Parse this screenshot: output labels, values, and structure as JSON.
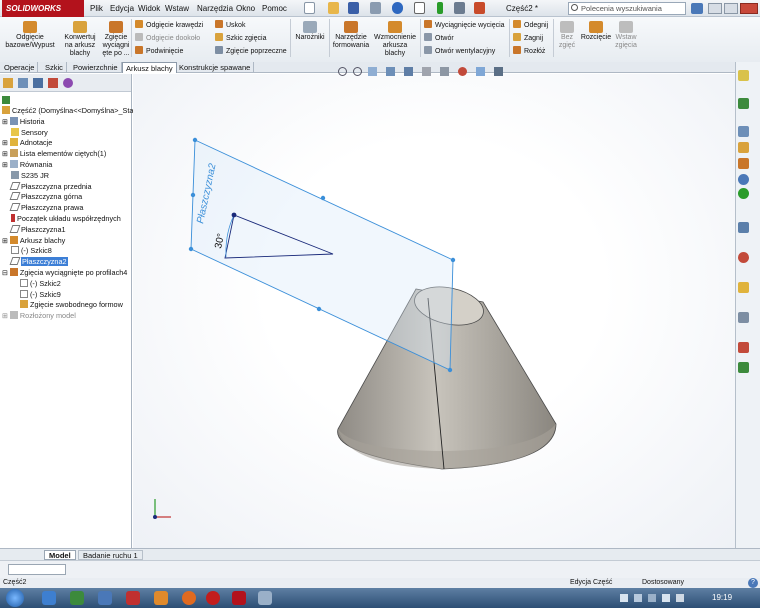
{
  "app": {
    "logo": "SOLIDWORKS",
    "doc_title": "Część2 *",
    "search_placeholder": "Polecenia wyszukiwania",
    "search_icon": "search-icon",
    "help_label": "?"
  },
  "menu": [
    "Plik",
    "Edycja",
    "Widok",
    "Wstaw",
    "Narzędzia",
    "Okno",
    "Pomoc"
  ],
  "ribbon": {
    "big": [
      {
        "label": "Odgięcie bazowe/Wypust"
      },
      {
        "label": "Konwertuj na arkusz blachy"
      },
      {
        "label": "Zgięcie wyciągni ęte po ..."
      }
    ],
    "col1": [
      "Odgięcie krawędzi",
      "Odgięcie dookoło",
      "Podwinięcie"
    ],
    "col2": [
      "Uskok",
      "Szkic zgięcia",
      "Zgięcie poprzeczne"
    ],
    "naroznik": "Narożniki",
    "big2": [
      {
        "label": "Narzędzie formowania"
      },
      {
        "label": "Wzmocnienie arkusza blachy"
      }
    ],
    "col3": [
      "Wyciągnięcie wycięcia",
      "Otwór",
      "Otwór wentylacyjny"
    ],
    "col4": [
      "Odegnij",
      "Zagnij",
      "Rozłóż"
    ],
    "big3": [
      {
        "label": "Bez zgięć"
      },
      {
        "label": "Rozcięcie"
      },
      {
        "label": "Wstaw zgięcia"
      }
    ]
  },
  "tabs": [
    "Operacje",
    "Szkic",
    "Powierzchnie",
    "Arkusz blachy",
    "Konstrukcje spawane"
  ],
  "active_tab": "Arkusz blachy",
  "tree": {
    "root": "Część2  (Domyślna<<Domyślna>_Sta",
    "items": [
      {
        "label": "Historia"
      },
      {
        "label": "Sensory"
      },
      {
        "label": "Adnotacje"
      },
      {
        "label": "Lista elementów ciętych(1)"
      },
      {
        "label": "Równania"
      },
      {
        "label": "S235 JR"
      },
      {
        "label": "Płaszczyzna przednia"
      },
      {
        "label": "Płaszczyzna górna"
      },
      {
        "label": "Płaszczyzna prawa"
      },
      {
        "label": "Początek układu współrzędnych"
      },
      {
        "label": "Płaszczyzna1"
      },
      {
        "label": "Arkusz blachy"
      },
      {
        "label": "(-) Szkic8"
      },
      {
        "label": "Płaszczyzna2"
      },
      {
        "label": "Zgięcia wyciągnięte po profilach4"
      },
      {
        "label": "(-) Szkic2"
      },
      {
        "label": "(-) Szkic9"
      },
      {
        "label": "Zgięcie swobodnego formow"
      },
      {
        "label": "Rozłożony model"
      }
    ]
  },
  "viewport": {
    "plane_label": "Płaszczyzna2",
    "angle_label": "30°"
  },
  "bottom_tabs": [
    "Model",
    "Badanie ruchu 1"
  ],
  "status": {
    "left": "Część2",
    "mode": "Edycja Część",
    "units": "Dostosowany",
    "help": "?"
  },
  "clock": "19:19",
  "colors": {
    "brand": "#b3121c",
    "plane": "#3b8fd9",
    "cone": "#a9a49b",
    "selection": "#3d7fd6"
  }
}
